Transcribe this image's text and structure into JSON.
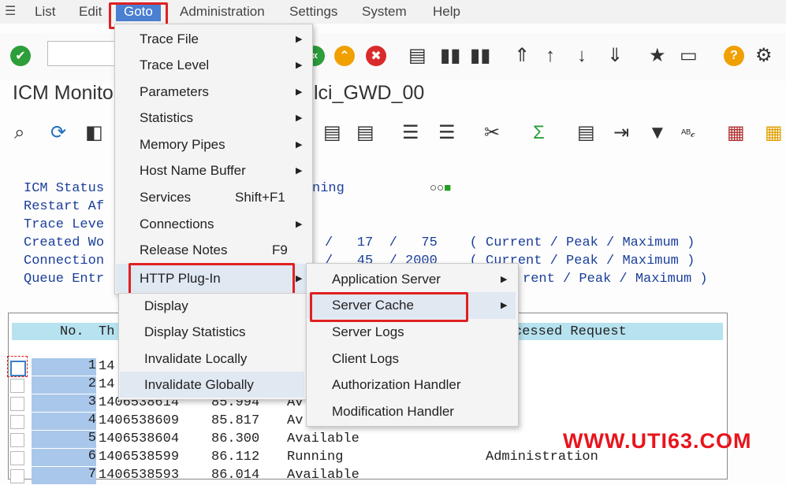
{
  "menubar": {
    "items": [
      "List",
      "Edit",
      "Goto",
      "Administration",
      "Settings",
      "System",
      "Help"
    ]
  },
  "title": {
    "left": "ICM Monito",
    "right": "lci_GWD_00"
  },
  "info_lines": [
    {
      "label": "ICM Status",
      "value": "ning"
    },
    {
      "label": "Restart Af",
      "value": ""
    },
    {
      "label": "Trace Leve",
      "value": ""
    },
    {
      "label": "Created Wo",
      "value": "/   17  /   75    ( Current / Peak / Maximum )"
    },
    {
      "label": "Connection",
      "value": "/   45  / 2000    ( Current / Peak / Maximum )"
    },
    {
      "label": "Queue Entr",
      "value": "rent / Peak / Maximum )"
    }
  ],
  "table": {
    "headers": [
      "No.",
      "Th",
      "cessed Request"
    ],
    "rows": [
      {
        "no": "1",
        "id": "14",
        "time": "",
        "status": "",
        "extra": ""
      },
      {
        "no": "2",
        "id": "14",
        "time": "",
        "status": "",
        "extra": ""
      },
      {
        "no": "3",
        "id": "1406538614",
        "time": "85.994",
        "status": "Av",
        "extra": ""
      },
      {
        "no": "4",
        "id": "1406538609",
        "time": "85.817",
        "status": "Av",
        "extra": ""
      },
      {
        "no": "5",
        "id": "1406538604",
        "time": "86.300",
        "status": "Available",
        "extra": ""
      },
      {
        "no": "6",
        "id": "1406538599",
        "time": "86.112",
        "status": "Running",
        "extra": "Administration"
      },
      {
        "no": "7",
        "id": "1406538593",
        "time": "86.014",
        "status": "Available",
        "extra": ""
      }
    ]
  },
  "goto_menu": {
    "items": [
      {
        "label": "Trace File",
        "shortcut": ""
      },
      {
        "label": "Trace Level",
        "shortcut": ""
      },
      {
        "label": "Parameters",
        "shortcut": ""
      },
      {
        "label": "Statistics",
        "shortcut": ""
      },
      {
        "label": "Memory Pipes",
        "shortcut": ""
      },
      {
        "label": "Host Name Buffer",
        "shortcut": ""
      },
      {
        "label": "Services",
        "shortcut": "Shift+F1"
      },
      {
        "label": "Connections",
        "shortcut": ""
      },
      {
        "label": "Release Notes",
        "shortcut": "F9"
      },
      {
        "label": "HTTP Plug-In",
        "shortcut": ""
      }
    ]
  },
  "plugin_menu": {
    "items": [
      "Application Server",
      "Server Cache",
      "Server Logs",
      "Client Logs",
      "Authorization Handler",
      "Modification Handler"
    ]
  },
  "cache_menu": {
    "items": [
      "Display",
      "Display Statistics",
      "Invalidate Locally",
      "Invalidate Globally"
    ]
  },
  "watermark": "WWW.UTI63.COM",
  "colors": {
    "highlight": "#e02020",
    "active_menu": "#4a7fd1",
    "table_header": "#b7e2ef",
    "row_number": "#a9c7ea"
  }
}
